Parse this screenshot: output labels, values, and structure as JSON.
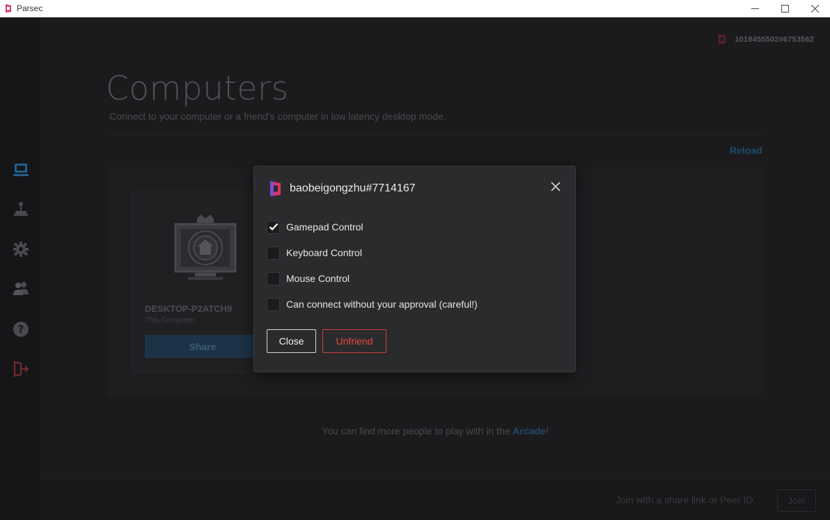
{
  "window": {
    "title": "Parsec",
    "controls": [
      "minimize-icon",
      "maximize-icon",
      "close-icon"
    ]
  },
  "sidebar": {
    "items": [
      {
        "name": "computers",
        "icon": "monitor-icon",
        "active": true
      },
      {
        "name": "arcade",
        "icon": "joystick-icon",
        "active": false
      },
      {
        "name": "settings",
        "icon": "gear-icon",
        "active": false
      },
      {
        "name": "friends",
        "icon": "users-icon",
        "active": false
      },
      {
        "name": "help",
        "icon": "question-icon",
        "active": false
      },
      {
        "name": "logout",
        "icon": "logout-icon",
        "active": false
      }
    ]
  },
  "header": {
    "user_id": "1018455502#6753562"
  },
  "main": {
    "title": "Computers",
    "subtitle": "Connect to your computer or a friend's computer in low latency desktop mode.",
    "reload_label": "Reload",
    "computer": {
      "name": "DESKTOP-P2ATCH9",
      "sub": "This Computer",
      "share_label": "Share"
    },
    "arcade_text": "You can find more people to play with in the ",
    "arcade_link": "Arcade",
    "arcade_suffix": "!"
  },
  "footer": {
    "join_placeholder": "Join with a share link or Peer ID.",
    "join_label": "Join"
  },
  "modal": {
    "title": "baobeigongzhu#7714167",
    "options": [
      {
        "label": "Gamepad Control",
        "checked": true
      },
      {
        "label": "Keyboard Control",
        "checked": false
      },
      {
        "label": "Mouse Control",
        "checked": false
      },
      {
        "label": "Can connect without your approval (careful!)",
        "checked": false
      }
    ],
    "close_label": "Close",
    "unfriend_label": "Unfriend"
  },
  "colors": {
    "accent_blue": "#1f4a6b",
    "brand_red": "#e5483f",
    "brand_pink": "#d6336c",
    "modal_bg": "#2b2b2e",
    "app_bg": "#1b1b1d"
  }
}
